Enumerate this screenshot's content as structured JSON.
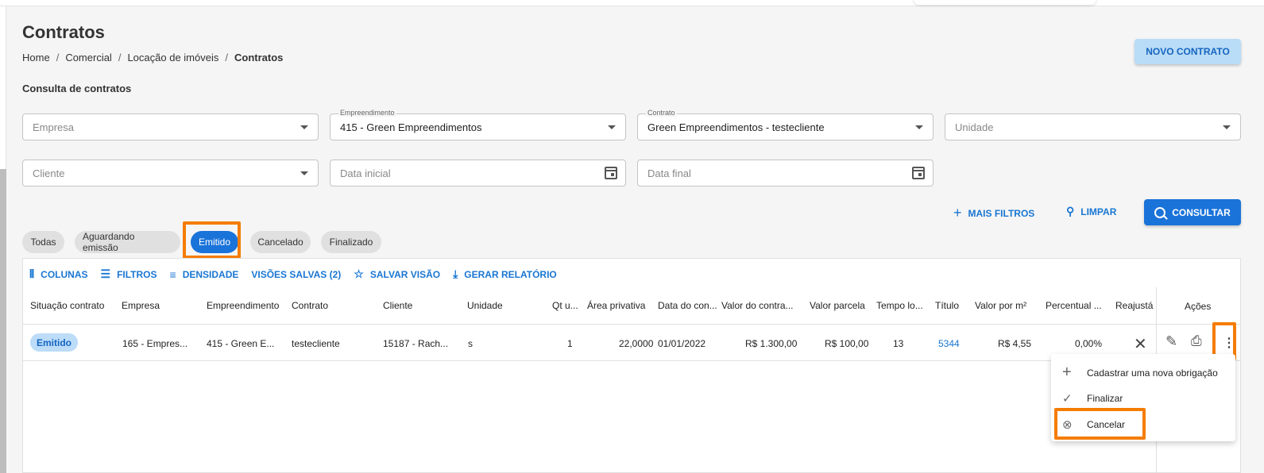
{
  "page": {
    "title": "Contratos",
    "breadcrumb": [
      "Home",
      "Comercial",
      "Locação de imóveis",
      "Contratos"
    ],
    "new_button": "NOVO CONTRATO",
    "section_title": "Consulta de contratos"
  },
  "filters": {
    "empresa": {
      "placeholder": "Empresa"
    },
    "empreendimento": {
      "label": "Empreendimento",
      "value": "415 - Green Empreendimentos"
    },
    "contrato": {
      "label": "Contrato",
      "value": "Green Empreendimentos - testecliente"
    },
    "unidade": {
      "placeholder": "Unidade"
    },
    "cliente": {
      "placeholder": "Cliente"
    },
    "data_inicial": {
      "placeholder": "Data inicial"
    },
    "data_final": {
      "placeholder": "Data final"
    }
  },
  "actions": {
    "mais_filtros": "MAIS FILTROS",
    "limpar": "LIMPAR",
    "consultar": "CONSULTAR"
  },
  "status_tabs": [
    "Todas",
    "Aguardando emissão",
    "Emitido",
    "Cancelado",
    "Finalizado"
  ],
  "active_tab": "Emitido",
  "toolbar": {
    "colunas": "COLUNAS",
    "filtros": "FILTROS",
    "densidade": "DENSIDADE",
    "visoes_salvas": "VISÕES SALVAS (2)",
    "salvar_visao": "SALVAR VISÃO",
    "gerar_relatorio": "GERAR RELATÓRIO"
  },
  "table": {
    "headers": [
      "Situação contrato",
      "Empresa",
      "Empreendimento",
      "Contrato",
      "Cliente",
      "Unidade",
      "Qt u...",
      "Área privativa",
      "Data do con...",
      "Valor do contra...",
      "Valor parcela",
      "Tempo lo...",
      "Título",
      "Valor por m²",
      "Percentual ...",
      "Reajustá",
      "Ações"
    ],
    "row": {
      "situacao": "Emitido",
      "empresa": "165 - Empres...",
      "empreendimento": "415 - Green E...",
      "contrato": "testecliente",
      "cliente": "15187 - Rach...",
      "unidade": "s",
      "qt": "1",
      "area": "22,0000",
      "data": "01/01/2022",
      "valor_contrato": "R$ 1.300,00",
      "valor_parcela": "R$ 100,00",
      "tempo": "13",
      "titulo": "5344",
      "valor_m2": "R$ 4,55",
      "percentual": "0,00%"
    }
  },
  "context_menu": [
    "Cadastrar uma nova obrigação",
    "Finalizar",
    "Cancelar"
  ],
  "colors": {
    "primary": "#1a73d9",
    "highlight": "#f57c00",
    "badge_bg": "#bcdcf8"
  }
}
